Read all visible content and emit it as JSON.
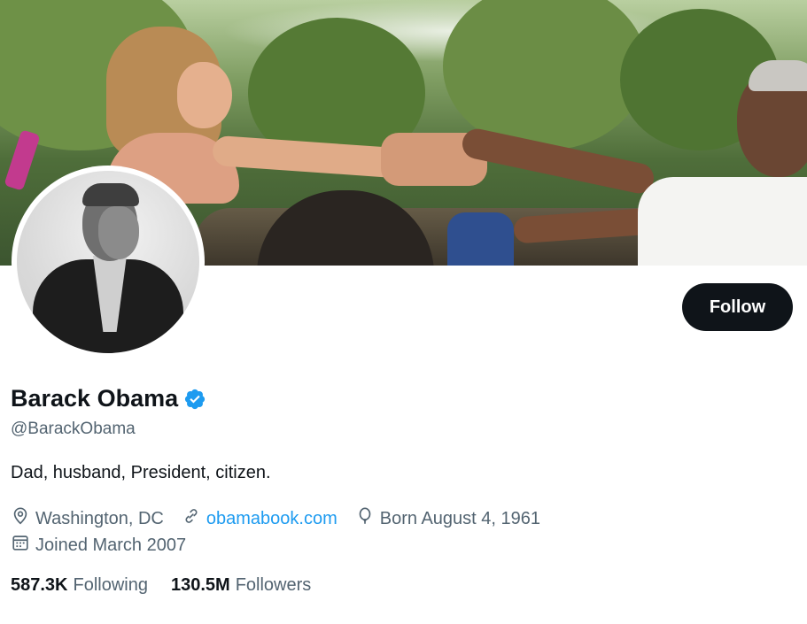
{
  "profile": {
    "name": "Barack Obama",
    "handle": "@BarackObama",
    "bio": "Dad, husband, President, citizen.",
    "location": "Washington, DC",
    "website": "obamabook.com",
    "birthday": "Born August 4, 1961",
    "joined": "Joined March 2007",
    "verified": true
  },
  "actions": {
    "follow_label": "Follow"
  },
  "stats": {
    "following_count": "587.3K",
    "following_label": "Following",
    "followers_count": "130.5M",
    "followers_label": "Followers"
  },
  "icons": {
    "verified": "verified-badge-icon",
    "location": "location-pin-icon",
    "link": "link-icon",
    "birthday": "balloon-icon",
    "joined": "calendar-icon"
  },
  "colors": {
    "accent": "#1d9bf0",
    "text_primary": "#0f1419",
    "text_secondary": "#536471",
    "button_bg": "#0f1419"
  }
}
